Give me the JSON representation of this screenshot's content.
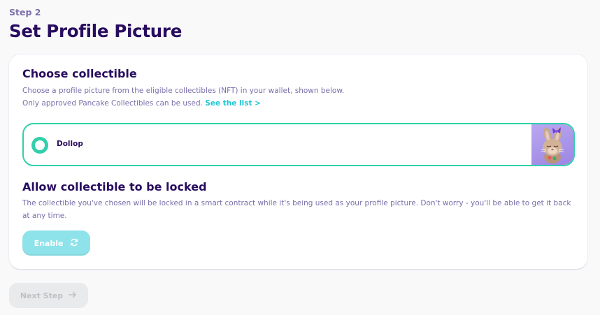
{
  "header": {
    "step_label": "Step 2",
    "title": "Set Profile Picture"
  },
  "collectible_section": {
    "title": "Choose collectible",
    "description_line1": "Choose a profile picture from the eligible collectibles (NFT) in your wallet, shown below.",
    "description_line2": "Only approved Pancake Collectibles can be used.",
    "link_label": "See the list >",
    "options": [
      {
        "label": "Dollop",
        "selected": true,
        "thumbnail_icon": "bunny-nft-image"
      }
    ]
  },
  "lock_section": {
    "title": "Allow collectible to be locked",
    "description": "The collectible you've chosen will be locked in a smart contract while it's being used as your profile picture. Don't worry - you'll be able to get it back at any time.",
    "enable_label": "Enable",
    "enable_icon": "refresh-icon"
  },
  "footer": {
    "next_label": "Next Step",
    "next_icon": "arrow-right-icon"
  },
  "colors": {
    "primary": "#1fc7d4",
    "success": "#31d0aa",
    "text": "#280d5f",
    "text_subtle": "#7a6eaa"
  }
}
